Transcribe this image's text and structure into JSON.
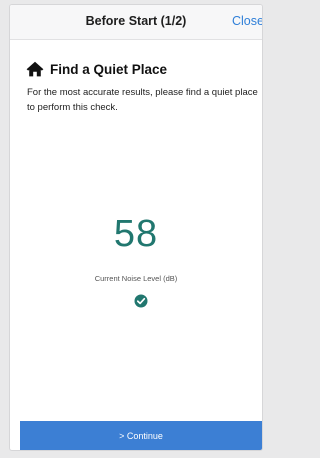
{
  "header": {
    "title": "Before Start (1/2)",
    "close_label": "Close"
  },
  "section": {
    "icon": "home-icon",
    "title": "Find a Quiet Place",
    "description": "For the most accurate results, please find a quiet place to perform this check."
  },
  "noise": {
    "value": "58",
    "label": "Current Noise Level (dB)",
    "status_icon": "check-circle-icon"
  },
  "footer": {
    "continue_label": "> Continue"
  },
  "colors": {
    "accent": "#3c7fd4",
    "noise_value": "#21776f",
    "close_link": "#2f7fd8"
  }
}
